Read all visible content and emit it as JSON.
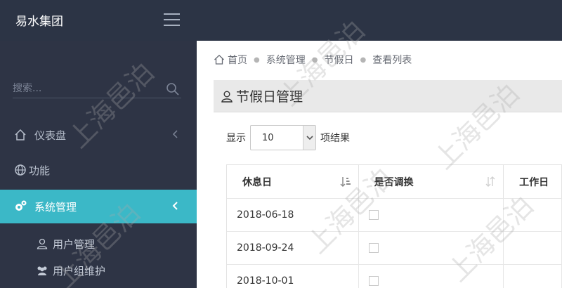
{
  "header": {
    "brand": "易水集团"
  },
  "sidebar": {
    "search_placeholder": "搜索...",
    "items": [
      {
        "label": "仪表盘",
        "icon": "home-icon"
      },
      {
        "label": "功能",
        "icon": "globe-icon"
      },
      {
        "label": "系统管理",
        "icon": "gears-icon",
        "active": true
      }
    ],
    "subitems": [
      {
        "label": "用户管理",
        "icon": "user-icon"
      },
      {
        "label": "用户组维护",
        "icon": "users-icon"
      }
    ]
  },
  "breadcrumb": [
    "首页",
    "系统管理",
    "节假日",
    "查看列表"
  ],
  "panel": {
    "title": "节假日管理"
  },
  "length_control": {
    "prefix": "显示",
    "value": "10",
    "suffix": "项结果"
  },
  "table": {
    "columns": [
      "休息日",
      "是否调换",
      "工作日"
    ],
    "rows": [
      {
        "date": "2018-06-18",
        "swapped": false,
        "workday": ""
      },
      {
        "date": "2018-09-24",
        "swapped": false,
        "workday": ""
      },
      {
        "date": "2018-10-01",
        "swapped": false,
        "workday": ""
      }
    ]
  },
  "watermark": "上海邑泊",
  "colors": {
    "topbar": "#2c3445",
    "sidebar": "#2e3445",
    "accent": "#3bb8c7"
  }
}
